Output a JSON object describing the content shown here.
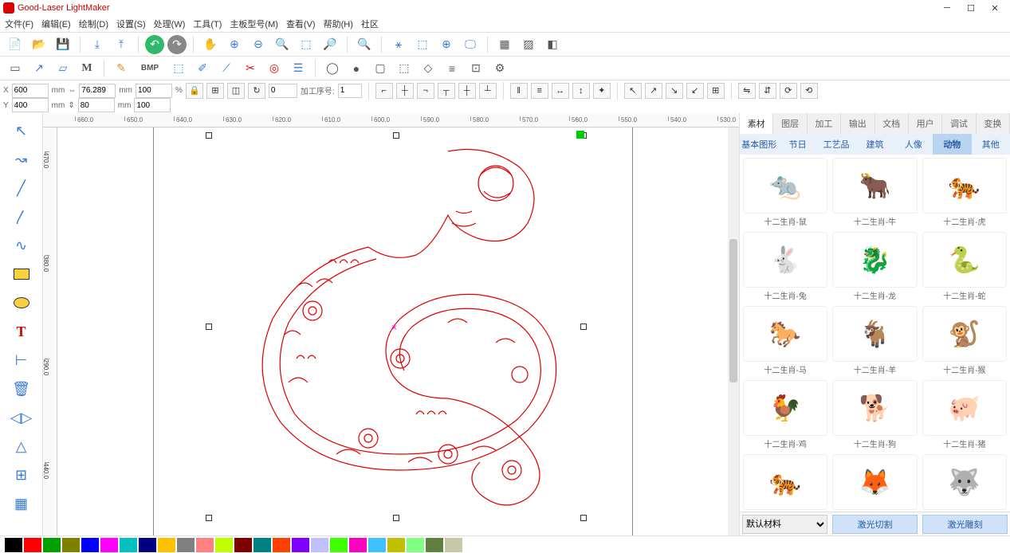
{
  "title": "Good-Laser LightMaker",
  "menus": [
    "文件(F)",
    "编辑(E)",
    "绘制(D)",
    "设置(S)",
    "处理(W)",
    "工具(T)",
    "主板型号(M)",
    "查看(V)",
    "帮助(H)",
    "社区"
  ],
  "coords": {
    "x_label": "X",
    "x_val": "600",
    "x_unit": "mm",
    "y_label": "Y",
    "y_val": "400",
    "y_unit": "mm",
    "w_val": "76.289",
    "w_unit": "mm",
    "h_val": "80",
    "h_unit": "mm",
    "sx": "100",
    "sy": "100",
    "pct": "%",
    "rotate": "0",
    "seq_label": "加工序号:",
    "seq_val": "1"
  },
  "ruler_h": [
    "660.0",
    "650.0",
    "640.0",
    "630.0",
    "620.0",
    "610.0",
    "600.0",
    "590.0",
    "580.0",
    "570.0",
    "560.0",
    "550.0",
    "540.0",
    "530.0"
  ],
  "ruler_v": [
    "470.0",
    "380.0",
    "290.0",
    "440.0"
  ],
  "right": {
    "tabs": [
      "素材",
      "图层",
      "加工",
      "输出",
      "文档",
      "用户",
      "调试",
      "变换"
    ],
    "cats": [
      "基本图形",
      "节日",
      "工艺品",
      "建筑",
      "人像",
      "动物",
      "其他"
    ],
    "items": [
      {
        "label": "十二生肖-鼠",
        "color": "#9dbf8e"
      },
      {
        "label": "十二生肖-牛",
        "color": "#2a3d7a"
      },
      {
        "label": "十二生肖-虎",
        "color": "#e8b030"
      },
      {
        "label": "十二生肖-兔",
        "color": "#e8a8b8"
      },
      {
        "label": "十二生肖-龙",
        "color": "#d89040"
      },
      {
        "label": "十二生肖-蛇",
        "color": "#2a3d7a"
      },
      {
        "label": "十二生肖-马",
        "color": "#b85040"
      },
      {
        "label": "十二生肖-羊",
        "color": "#c88868"
      },
      {
        "label": "十二生肖-猴",
        "color": "#d89040"
      },
      {
        "label": "十二生肖-鸡",
        "color": "#b8d0a8"
      },
      {
        "label": "十二生肖-狗",
        "color": "#d8c030"
      },
      {
        "label": "十二生肖-猪",
        "color": "#d898a8"
      },
      {
        "label": "",
        "color": "#333"
      },
      {
        "label": "",
        "color": "#333"
      },
      {
        "label": "",
        "color": "#333"
      }
    ],
    "material": "默认材料",
    "btn_cut": "激光切割",
    "btn_engrave": "激光雕刻"
  },
  "colors": [
    "#000000",
    "#ff0000",
    "#00a000",
    "#808000",
    "#0000ff",
    "#ff00ff",
    "#00c0c0",
    "#000080",
    "#ffc000",
    "#808080",
    "#ff8080",
    "#c0ff00",
    "#800000",
    "#008080",
    "#ff4000",
    "#8000ff",
    "#c0c0ff",
    "#40ff00",
    "#ff00c0",
    "#40c0ff",
    "#c0c000",
    "#80ff80",
    "#608040",
    "#c8c8a8"
  ],
  "bmp_label": "BMP"
}
